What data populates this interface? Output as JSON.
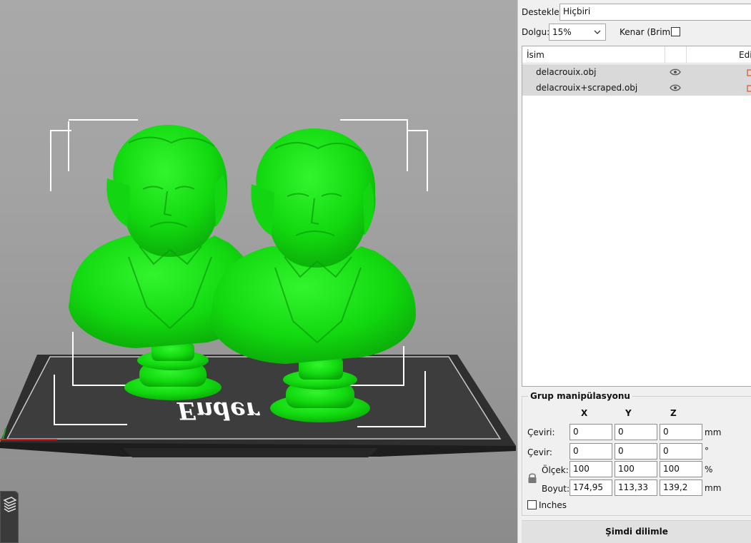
{
  "settings": {
    "supports_label": "Destekler:",
    "supports_value": "Hiçbiri",
    "infill_label": "Dolgu:",
    "infill_value": "15%",
    "brim_label": "Kenar (Brim):",
    "brim_checked": false
  },
  "object_list": {
    "columns": [
      "İsim",
      "",
      "Edit"
    ],
    "items": [
      {
        "name": "delacrouix.obj",
        "visible": true,
        "icon": "eye-icon"
      },
      {
        "name": "delacrouix+scraped.obj",
        "visible": true,
        "icon": "eye-icon"
      }
    ]
  },
  "manipulation": {
    "title": "Grup manipülasyonu",
    "axes": [
      "X",
      "Y",
      "Z"
    ],
    "rows": [
      {
        "label": "Çeviri:",
        "values": [
          "0",
          "0",
          "0"
        ],
        "unit": "mm"
      },
      {
        "label": "Çevir:",
        "values": [
          "0",
          "0",
          "0"
        ],
        "unit": "°"
      },
      {
        "label": "Ölçek:",
        "values": [
          "100",
          "100",
          "100"
        ],
        "unit": "%"
      },
      {
        "label": "Boyut:",
        "values": [
          "174,95",
          "113,33",
          "139,2"
        ],
        "unit": "mm"
      }
    ],
    "inches_label": "Inches",
    "inches_checked": false,
    "lock_icon": "lock-icon"
  },
  "slice_button": "Şimdi dilimle",
  "viewport": {
    "bed_logo_text": "Ender",
    "model_color": "#1fe81a",
    "background_color": "#a3a3a3",
    "layers_icon": "layers-icon"
  }
}
